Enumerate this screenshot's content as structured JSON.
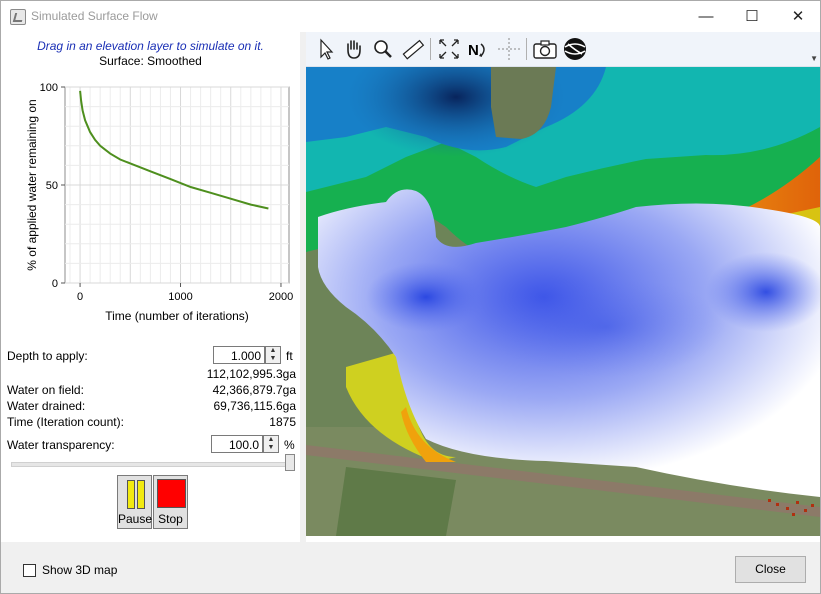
{
  "window": {
    "title": "Simulated Surface Flow",
    "minimize": "—",
    "maximize": "☐",
    "close": "✕"
  },
  "left": {
    "hint": "Drag in an elevation layer to simulate on it.",
    "surface": "Surface: Smoothed",
    "chart_data": {
      "type": "line",
      "ylabel": "% of applied water remaining on",
      "xlabel": "Time (number of iterations)",
      "xlim": [
        -150,
        2080
      ],
      "ylim": [
        0,
        100
      ],
      "xticks": [
        "0",
        "1000",
        "2000"
      ],
      "yticks": [
        "0",
        "50",
        "100"
      ],
      "grid": true,
      "series": [
        {
          "color": "#4e8f1e",
          "x": [
            0,
            10,
            25,
            50,
            75,
            100,
            150,
            200,
            250,
            300,
            400,
            500,
            700,
            900,
            1100,
            1300,
            1500,
            1700,
            1875
          ],
          "y": [
            98,
            93,
            88,
            83,
            80,
            77,
            73,
            70,
            68,
            66,
            63,
            61,
            57,
            53,
            49,
            46,
            43,
            40,
            38
          ]
        }
      ]
    },
    "depth": {
      "label": "Depth to apply:",
      "value": "1.000",
      "unit": "ft",
      "volume": "112,102,995.3ga"
    },
    "stats": [
      {
        "label": "Water on field:",
        "value": "42,366,879.7ga"
      },
      {
        "label": "Water drained:",
        "value": "69,736,115.6ga"
      },
      {
        "label": "Time (Iteration count):",
        "value": "1875"
      }
    ],
    "transparency": {
      "label": "Water transparency:",
      "value": "100.0",
      "unit": "%",
      "level": 1.0
    },
    "pause_label": "Pause",
    "stop_label": "Stop"
  },
  "toolbar": {
    "tools": [
      "select-arrow-icon",
      "pan-hand-icon",
      "zoom-magnifier-icon",
      "measure-ruler-icon",
      "zoom-extents-icon",
      "north-rotate-icon",
      "crosshair-icon",
      "camera-icon",
      "globe-icon"
    ]
  },
  "footer": {
    "show3d_label": "Show 3D map",
    "close_label": "Close"
  },
  "colors": {
    "accent_blue": "#1a2fb5",
    "pause_yellow": "#f2ea10",
    "stop_red": "#ff0000",
    "series_green": "#4e8f1e"
  }
}
